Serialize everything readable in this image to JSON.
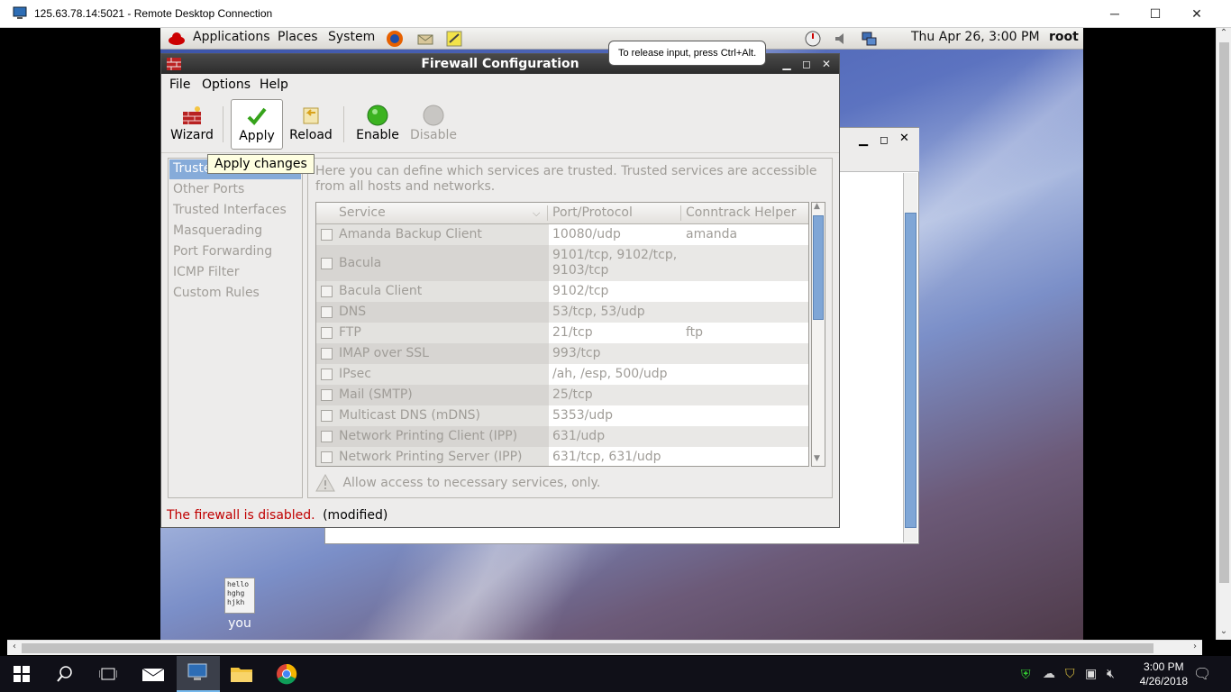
{
  "rdp": {
    "title": "125.63.78.14:5021 - Remote Desktop Connection",
    "minimize": "─",
    "maximize": "☐",
    "close": "✕"
  },
  "gnome_panel": {
    "menus": [
      "Applications",
      "Places",
      "System"
    ],
    "datetime": "Thu Apr 26,  3:00 PM",
    "user": "root"
  },
  "release_tooltip": "To release input, press Ctrl+Alt.",
  "firewall": {
    "title": "Firewall Configuration",
    "menu": [
      "File",
      "Options",
      "Help"
    ],
    "toolbar": [
      {
        "label": "Wizard",
        "icon": "wizard-icon"
      },
      {
        "label": "Apply",
        "icon": "apply-checkmark-icon"
      },
      {
        "label": "Reload",
        "icon": "reload-icon"
      },
      {
        "label": "Enable",
        "icon": "enable-green-icon"
      },
      {
        "label": "Disable",
        "icon": "disable-gray-icon"
      }
    ],
    "apply_tooltip": "Apply changes",
    "sidebar": [
      "Trusted Services",
      "Other Ports",
      "Trusted Interfaces",
      "Masquerading",
      "Port Forwarding",
      "ICMP Filter",
      "Custom Rules"
    ],
    "sidebar_visible_first": "Truste",
    "description": "Here you can define which services are trusted. Trusted services are accessible from all hosts and networks.",
    "columns": [
      "Service",
      "Port/Protocol",
      "Conntrack Helper"
    ],
    "services": [
      {
        "name": "Amanda Backup Client",
        "port": "10080/udp",
        "helper": "amanda"
      },
      {
        "name": "Bacula",
        "port": "9101/tcp, 9102/tcp, 9103/tcp",
        "helper": ""
      },
      {
        "name": "Bacula Client",
        "port": "9102/tcp",
        "helper": ""
      },
      {
        "name": "DNS",
        "port": "53/tcp, 53/udp",
        "helper": ""
      },
      {
        "name": "FTP",
        "port": "21/tcp",
        "helper": "ftp"
      },
      {
        "name": "IMAP over SSL",
        "port": "993/tcp",
        "helper": ""
      },
      {
        "name": "IPsec",
        "port": "/ah, /esp, 500/udp",
        "helper": ""
      },
      {
        "name": "Mail (SMTP)",
        "port": "25/tcp",
        "helper": ""
      },
      {
        "name": "Multicast DNS (mDNS)",
        "port": "5353/udp",
        "helper": ""
      },
      {
        "name": "Network Printing Client (IPP)",
        "port": "631/udp",
        "helper": ""
      },
      {
        "name": "Network Printing Server (IPP)",
        "port": "631/tcp, 631/udp",
        "helper": ""
      }
    ],
    "hint": "Allow access to necessary services, only.",
    "status_red": "The firewall is disabled.",
    "status_modified": "(modified)"
  },
  "desktop_icon": {
    "label": "you",
    "preview": "hello\nhghg\nhjkh"
  },
  "taskbar": {
    "time": "3:00 PM",
    "date": "4/26/2018"
  },
  "colors": {
    "selection": "#86abd9",
    "status_red": "#c00000",
    "taskbar": "#101018"
  }
}
